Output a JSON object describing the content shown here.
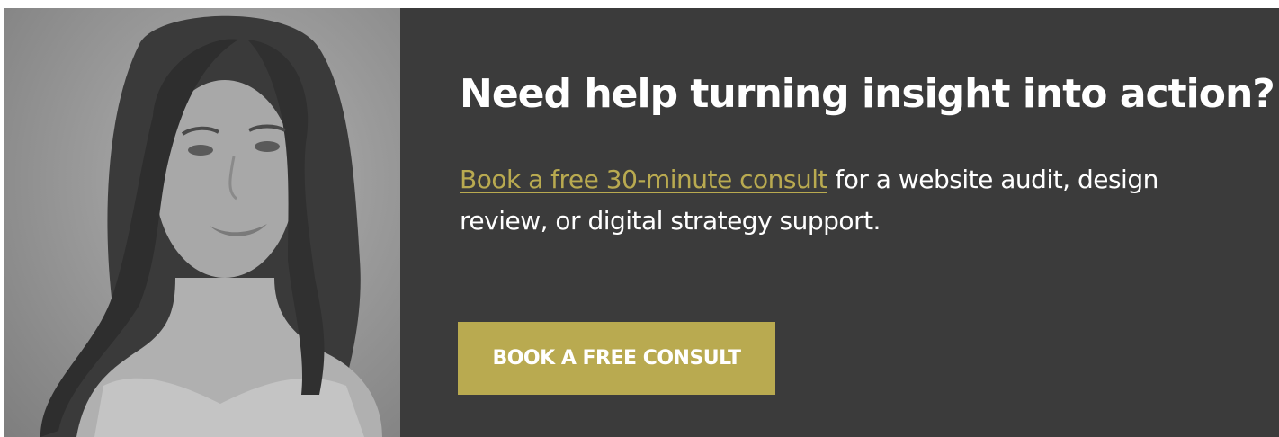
{
  "photo": {
    "alt": "Portrait photo",
    "icon": "portrait-photo"
  },
  "content": {
    "headline": "Need help turning insight into action?",
    "link_text": "Book a free 30-minute consult",
    "body_rest": " for a website audit, design review, or digital strategy support.",
    "cta_label": "BOOK A FREE CONSULT"
  },
  "colors": {
    "panel_bg": "#3b3b3b",
    "accent": "#b9aa50",
    "text": "#ffffff"
  }
}
